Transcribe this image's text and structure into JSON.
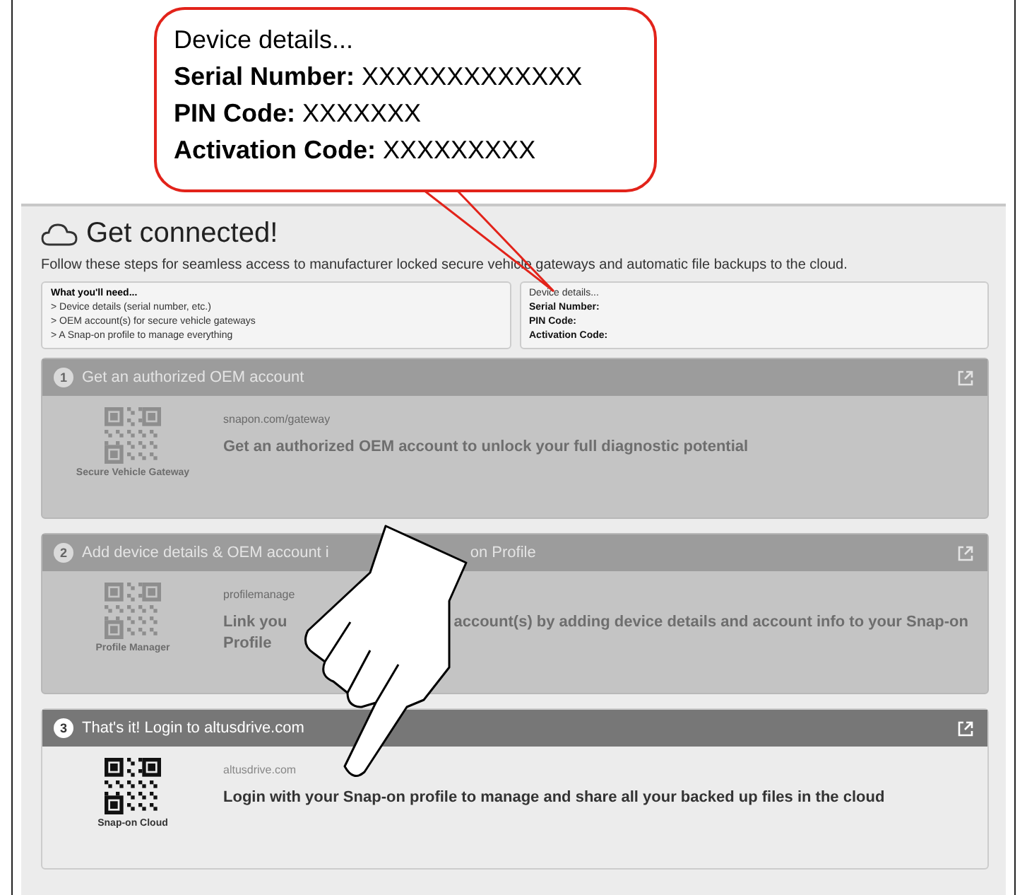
{
  "callout": {
    "title": "Device details...",
    "lines": [
      "**Serial Number:** XXXXXXXXXXXXX",
      "**PIN Code:** XXXXXXX",
      "**Activation Code:** XXXXXXXXX"
    ]
  },
  "page": {
    "title": "Get connected!",
    "subtitle": "Follow these steps for seamless access to manufacturer locked secure vehicle gateways and automatic file backups to the cloud."
  },
  "needs": {
    "title": "What you'll need...",
    "items": [
      "> Device details (serial number, etc.)",
      "> OEM account(s) for secure vehicle gateways",
      "> A Snap-on profile to manage everything"
    ]
  },
  "device_details": {
    "title": "Device details...",
    "fields": [
      "Serial Number:",
      "PIN Code:",
      "Activation Code:"
    ]
  },
  "steps": [
    {
      "number": "1",
      "title_parts": [
        "Get an authorized OEM account"
      ],
      "disabled": true,
      "qr_label": "Secure Vehicle Gateway",
      "url": "snapon.com/gateway",
      "description_lines": [
        [
          "Get an authorized OEM account to unlock your full diagnostic potential"
        ]
      ]
    },
    {
      "number": "2",
      "title_parts": [
        "Add device details & OEM account i",
        "on Profile"
      ],
      "disabled": true,
      "qr_label": "Profile Manager",
      "url": "profilemanage",
      "description_lines": [
        [
          "Link you",
          "account(s) by adding device details and account info to your Snap-on"
        ],
        [
          "Profile"
        ]
      ]
    },
    {
      "number": "3",
      "title_parts": [
        "That's it! Login to altusdrive.com"
      ],
      "disabled": false,
      "qr_label": "Snap-on Cloud",
      "url": "altusdrive.com",
      "description_lines": [
        [
          "Login with your Snap-on profile to manage and share all your backed up files in the cloud"
        ]
      ]
    }
  ]
}
